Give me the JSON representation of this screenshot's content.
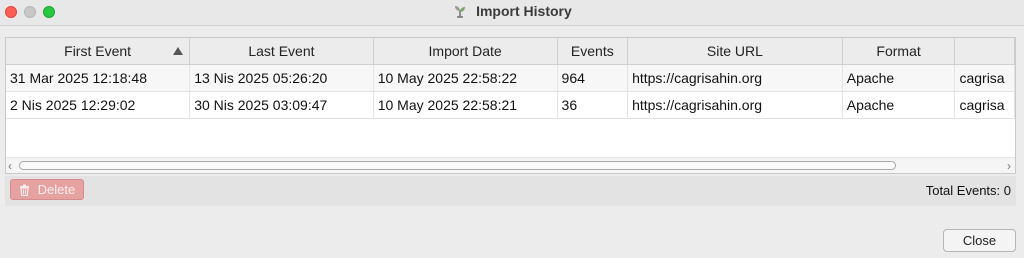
{
  "window": {
    "title": "Import History"
  },
  "table": {
    "columns": [
      {
        "label": "First Event",
        "sorted": "ascending"
      },
      {
        "label": "Last Event"
      },
      {
        "label": "Import Date"
      },
      {
        "label": "Events"
      },
      {
        "label": "Site URL"
      },
      {
        "label": "Format"
      },
      {
        "label": ""
      }
    ],
    "rows": [
      [
        "31 Mar 2025 12:18:48",
        "13 Nis 2025 05:26:20",
        "10 May 2025 22:58:22",
        "964",
        "https://cagrisahin.org",
        "Apache",
        "cagrisa"
      ],
      [
        "2 Nis 2025 12:29:02",
        "30 Nis 2025 03:09:47",
        "10 May 2025 22:58:21",
        "36",
        "https://cagrisahin.org",
        "Apache",
        "cagrisa"
      ]
    ]
  },
  "actions": {
    "delete_label": "Delete",
    "total_events": "Total Events: 0",
    "close_label": "Close"
  },
  "colors": {
    "delete_bg": "#e6a1a1",
    "close_dot": "#ff5f57",
    "maximize_dot": "#28c840"
  },
  "icons": {
    "title_icon": "import-app-icon",
    "delete_icon": "trash-icon",
    "sort_icon": "sort-ascending-icon"
  }
}
